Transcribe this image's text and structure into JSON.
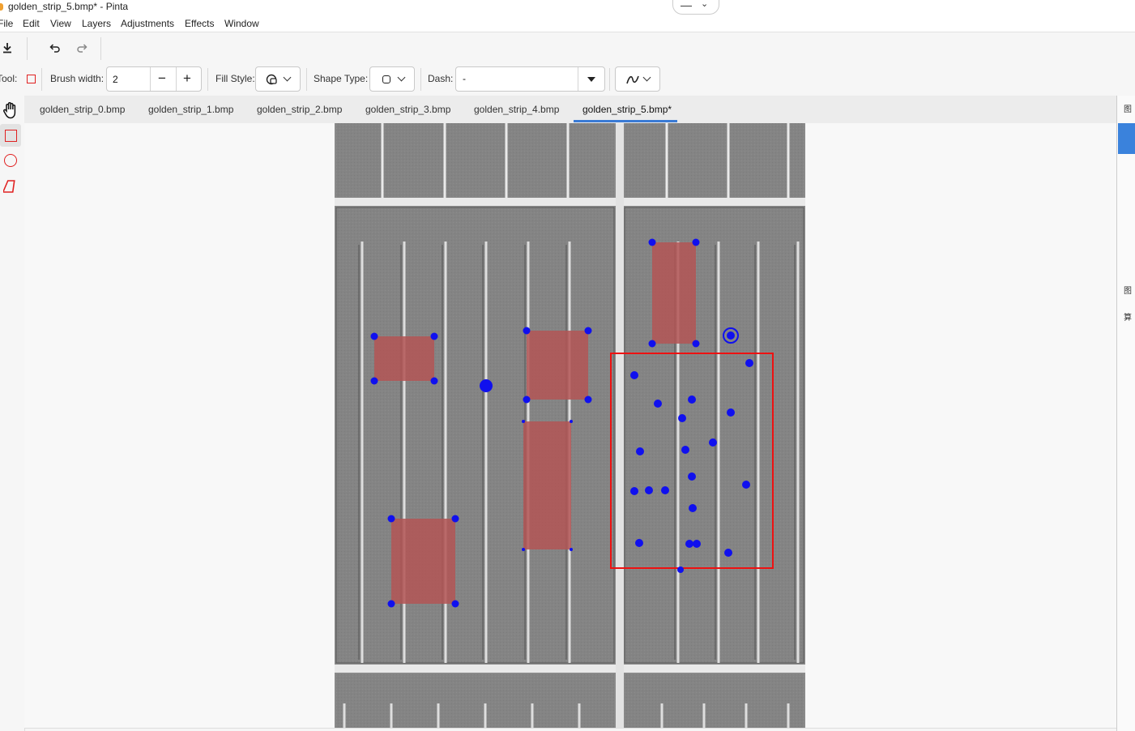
{
  "window": {
    "title": "golden_strip_5.bmp* - Pinta"
  },
  "menu": [
    "File",
    "Edit",
    "View",
    "Layers",
    "Adjustments",
    "Effects",
    "Window"
  ],
  "toolbar2": {
    "tool_label": "Tool:",
    "brush_width_label": "Brush width:",
    "brush_width_value": "2",
    "fill_style_label": "Fill Style:",
    "shape_type_label": "Shape Type:",
    "dash_label": "Dash:",
    "dash_value": "-"
  },
  "tabs": [
    "golden_strip_0.bmp",
    "golden_strip_1.bmp",
    "golden_strip_2.bmp",
    "golden_strip_3.bmp",
    "golden_strip_4.bmp",
    "golden_strip_5.bmp*"
  ],
  "active_tab_index": 5,
  "right_panel": [
    "图",
    "图",
    "算"
  ],
  "icons": {
    "save": "download-icon",
    "undo": "undo-icon",
    "redo": "redo-icon",
    "pan": "hand-icon",
    "rectangle": "rectangle-icon",
    "ellipse": "ellipse-icon",
    "freeform": "freeform-shape-icon"
  },
  "colors": {
    "accent": "#3a7bd5",
    "marker": "#1010ee",
    "region_fill": "#b35555",
    "selection": "#ee1111",
    "image_bg": "#838383"
  }
}
